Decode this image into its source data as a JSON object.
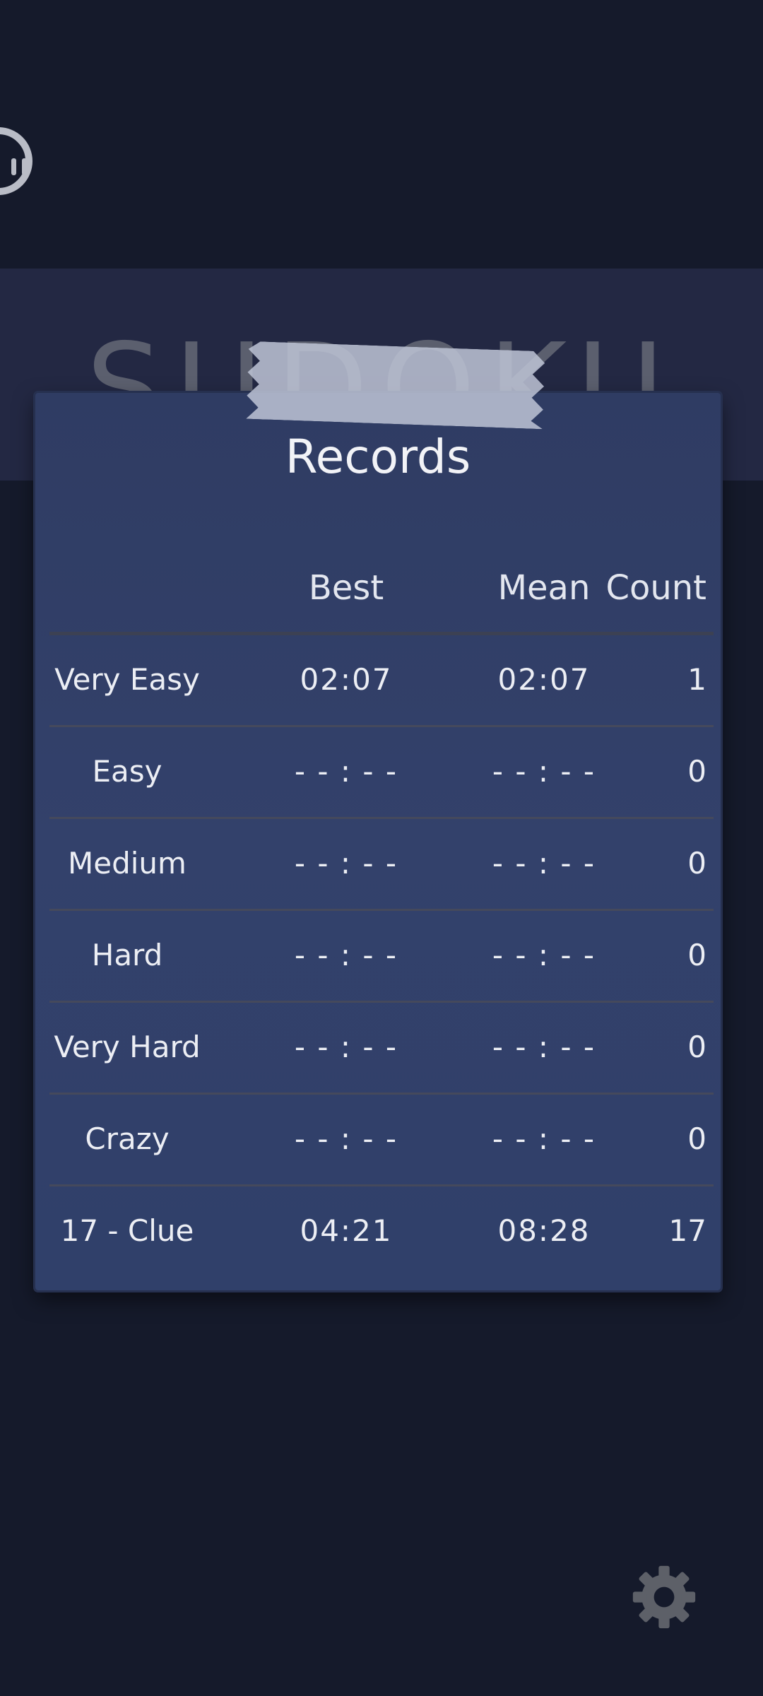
{
  "header": {
    "title": "SUDOKU"
  },
  "records": {
    "title": "Records",
    "columns": {
      "best": "Best",
      "mean": "Mean",
      "count": "Count"
    },
    "rows": [
      {
        "name": "Very Easy",
        "best": "02:07",
        "mean": "02:07",
        "count": "1"
      },
      {
        "name": "Easy",
        "best": "- - : - -",
        "mean": "- - : - -",
        "count": "0"
      },
      {
        "name": "Medium",
        "best": "- - : - -",
        "mean": "- - : - -",
        "count": "0"
      },
      {
        "name": "Hard",
        "best": "- - : - -",
        "mean": "- - : - -",
        "count": "0"
      },
      {
        "name": "Very Hard",
        "best": "- - : - -",
        "mean": "- - : - -",
        "count": "0"
      },
      {
        "name": "Crazy",
        "best": "- - : - -",
        "mean": "- - : - -",
        "count": "0"
      },
      {
        "name": "17 - Clue",
        "best": "04:21",
        "mean": "08:28",
        "count": "17"
      }
    ]
  },
  "icons": {
    "pause": "pause-icon",
    "settings": "gear-icon"
  },
  "colors": {
    "background": "#151a2b",
    "title_band": "#232843",
    "card": "#33416b",
    "text": "#eceef4",
    "muted": "#5b5f6e"
  }
}
